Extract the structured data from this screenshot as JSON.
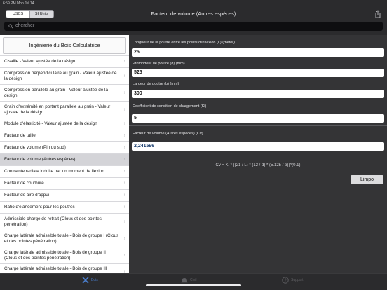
{
  "statusbar": {
    "time": "6:59 PM  Mon Jul 14",
    "battery": ""
  },
  "header": {
    "units_tab_usc": "USCS",
    "units_tab_si": "SI Units",
    "title": "Facteur de volume (Autres espèces)"
  },
  "search": {
    "placeholder": "chercher"
  },
  "sidebar": {
    "heading": "Ingénierie du Bois Calculatrice",
    "items": [
      {
        "label": "Cisaille - Valeur ajustée de la désign"
      },
      {
        "label": "Compression perpendiculaire au grain - Valeur ajustée de la désign"
      },
      {
        "label": "Compression parallèle au grain - Valeur ajustée de la désign"
      },
      {
        "label": "Grain d'extrémité en portant parallèle au grain - Valeur ajustée de la désign"
      },
      {
        "label": "Module d'élasticité - Valeur ajustée de la désign"
      },
      {
        "label": "Facteur de taille"
      },
      {
        "label": "Facteur de volume (Pin du sud)"
      },
      {
        "label": "Facteur de volume (Autres espèces)"
      },
      {
        "label": "Contrainte radiale induite par un moment de flexion"
      },
      {
        "label": "Facteur de courbure"
      },
      {
        "label": "Facteur de aire d'appui"
      },
      {
        "label": "Ratio d'élancement pour les poutres"
      },
      {
        "label": "Admissible charge de retrait (Clous et des pointes pénétration)"
      },
      {
        "label": "Charge latérale admissible totale - Bois de groupe I (Clous et des pointes pénétration)"
      },
      {
        "label": "Charge latérale admissible totale - Bois de groupe II (Clous et des pointes pénétration)"
      },
      {
        "label": "Charge latérale admissible totale - Bois de groupe III"
      }
    ]
  },
  "panel": {
    "length_label": "Longueur de la poutre entre les points d'inflexion (L) (meter)",
    "length_value": "25",
    "depth_label": "Profondeur de poutre (d) (mm)",
    "depth_value": "525",
    "width_label": "Largeur de poutre (b) (mm)",
    "width_value": "300",
    "kl_label": "Coefficient de condition de chargement (Kl)",
    "kl_value": "5",
    "result_label": "Facteur de volume (Autres espèces) (Cv)",
    "result_value": "2,241596",
    "formula": "Cv = Kl * ((21 / L) * (12 / d) * (5.125 / b))^(0.1)",
    "clear_button": "Limpo"
  },
  "tabbar": {
    "tab_wood": "Bois",
    "tab_civil": "Civil",
    "tab_support": "Support"
  },
  "colors": {
    "accent": "#4a7fcf",
    "result_text": "#1b3e6e"
  }
}
